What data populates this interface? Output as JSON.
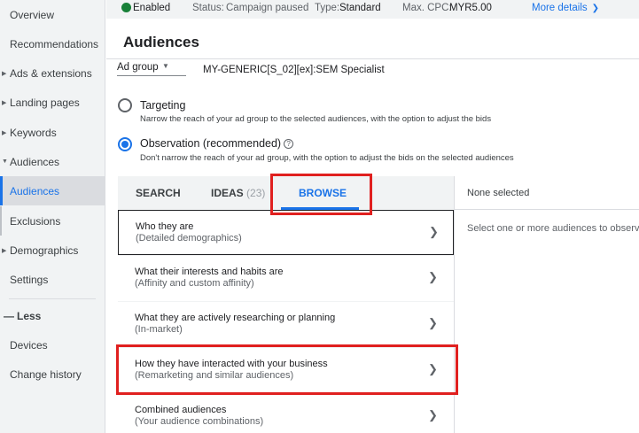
{
  "sidebar": {
    "items": [
      {
        "label": "Overview"
      },
      {
        "label": "Recommendations"
      },
      {
        "label": "Ads & extensions"
      },
      {
        "label": "Landing pages"
      },
      {
        "label": "Keywords"
      },
      {
        "label": "Audiences"
      },
      {
        "label": "Audiences"
      },
      {
        "label": "Exclusions"
      },
      {
        "label": "Demographics"
      },
      {
        "label": "Settings"
      },
      {
        "label": "Less"
      },
      {
        "label": "Devices"
      },
      {
        "label": "Change history"
      }
    ]
  },
  "status_bar": {
    "enabled": "Enabled",
    "status_label": "Status:",
    "status_value": "Campaign paused",
    "type_label": "Type:",
    "type_value": "Standard",
    "cpc_label": "Max. CPC:",
    "cpc_value": "MYR5.00",
    "more_details": "More details",
    "colors": {
      "enabled_dot": "#188038",
      "link": "#1a73e8"
    }
  },
  "header": {
    "title": "Audiences"
  },
  "ad_group": {
    "label": "Ad group",
    "name": "MY-GENERIC[S_02][ex]:SEM Specialist"
  },
  "options": {
    "targeting": {
      "title": "Targeting",
      "description": "Narrow the reach of your ad group to the selected audiences, with the option to adjust the bids"
    },
    "observation": {
      "title": "Observation (recommended)",
      "description": "Don't narrow the reach of your ad group, with the option to adjust the bids on the selected audiences"
    }
  },
  "tabs": {
    "search": "SEARCH",
    "ideas": "IDEAS",
    "ideas_count": "(23)",
    "browse": "BROWSE"
  },
  "browse_list": [
    {
      "title": "Who they are",
      "subtitle": "(Detailed demographics)"
    },
    {
      "title": "What their interests and habits are",
      "subtitle": "(Affinity and custom affinity)"
    },
    {
      "title": "What they are actively researching or planning",
      "subtitle": "(In-market)"
    },
    {
      "title": "How they have interacted with your business",
      "subtitle": "(Remarketing and similar audiences)"
    },
    {
      "title": "Combined audiences",
      "subtitle": "(Your audience combinations)"
    }
  ],
  "selection_panel": {
    "title": "None selected",
    "hint": "Select one or more audiences to observe"
  },
  "highlight_color": "#e0201f"
}
